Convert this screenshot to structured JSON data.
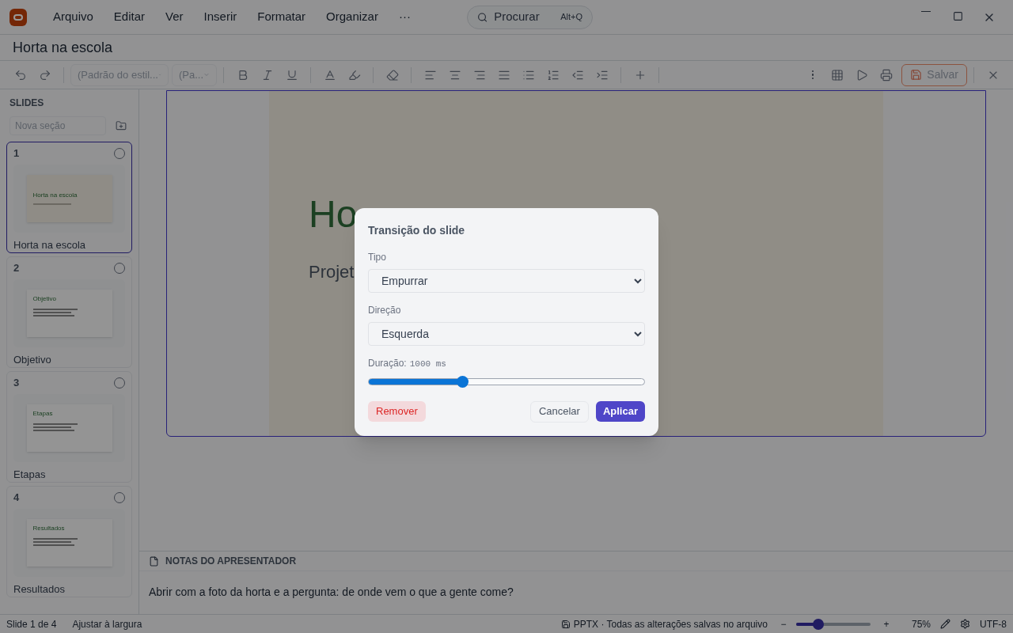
{
  "menu": [
    "Arquivo",
    "Editar",
    "Ver",
    "Inserir",
    "Formatar",
    "Organizar",
    "···"
  ],
  "search": {
    "placeholder": "Procurar",
    "shortcut": "Alt+Q"
  },
  "document_title": "Horta na escola",
  "toolbar": {
    "style_select": "(Padrão do estil...",
    "size_select": "(Pa...",
    "save_button": "Salvar"
  },
  "sidebar": {
    "heading": "SLIDES",
    "section_placeholder": "Nova seção",
    "slides": [
      {
        "number": "1",
        "title": "Horta na escola",
        "selected": true,
        "checked": false,
        "thumb_title": "Horta na escola",
        "kind": "cover"
      },
      {
        "number": "2",
        "title": "Objetivo",
        "selected": false,
        "checked": false,
        "thumb_title": "Objetivo",
        "kind": "bullets"
      },
      {
        "number": "3",
        "title": "Etapas",
        "selected": false,
        "checked": false,
        "thumb_title": "Etapas",
        "kind": "bullets"
      },
      {
        "number": "4",
        "title": "Resultados",
        "selected": false,
        "checked": false,
        "thumb_title": "Resultados",
        "kind": "bullets"
      }
    ]
  },
  "slide": {
    "title": "Ho",
    "subtitle": "Projet"
  },
  "notes": {
    "heading": "NOTAS DO APRESENTADOR",
    "text": "Abrir com a foto da horta e a pergunta: de onde vem o que a gente come?"
  },
  "dialog": {
    "title": "Transição do slide",
    "type_label": "Tipo",
    "type_value": "Empurrar",
    "direction_label": "Direção",
    "direction_value": "Esquerda",
    "duration_label": "Duração:",
    "duration_value": "1000 ms",
    "level": 0.34,
    "remove_button": "Remover",
    "cancel_button": "Cancelar",
    "apply_button": "Aplicar"
  },
  "status_bar": {
    "slide_position": "Slide 1 de 4",
    "fit": "Ajustar à largura",
    "save_status": "PPTX · Todas as alterações salvas no arquivo",
    "zoom_out": "−",
    "zoom_slider": {
      "level": 0.3
    },
    "zoom_in": "+",
    "zoom": "75%",
    "encoding": "UTF-8"
  }
}
